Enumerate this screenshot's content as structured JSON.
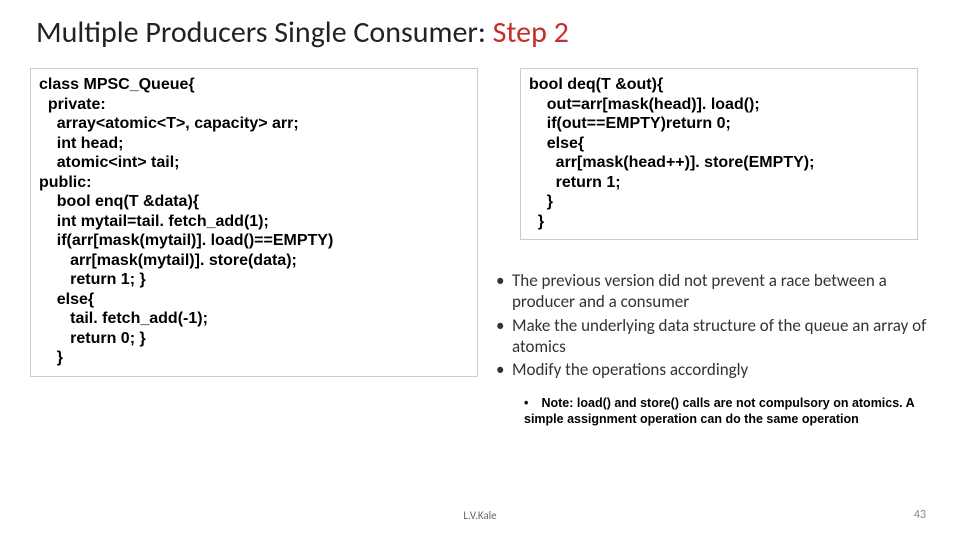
{
  "title_black": "Multiple Producers Single Consumer: ",
  "title_red": "Step 2",
  "code_left": "class MPSC_Queue{\n  private:\n    array<atomic<T>, capacity> arr;\n    int head;\n    atomic<int> tail;\npublic:\n    bool enq(T &data){\n    int mytail=tail. fetch_add(1);\n    if(arr[mask(mytail)]. load()==EMPTY)\n       arr[mask(mytail)]. store(data);\n       return 1; }\n    else{\n       tail. fetch_add(-1);\n       return 0; }\n    }",
  "code_right": "bool deq(T &out){\n    out=arr[mask(head)]. load();\n    if(out==EMPTY)return 0;\n    else{\n      arr[mask(head++)]. store(EMPTY);\n      return 1;\n    }\n  }",
  "bullets": [
    "The previous version did not prevent a race between a producer and a consumer",
    "Make the underlying data structure of the queue an array of atomics",
    "Modify the operations accordingly"
  ],
  "subnote": "Note: load() and store() calls are not compulsory on atomics. A simple assignment operation can do the same operation",
  "footer_author": "L.V.Kale",
  "footer_page": "43"
}
